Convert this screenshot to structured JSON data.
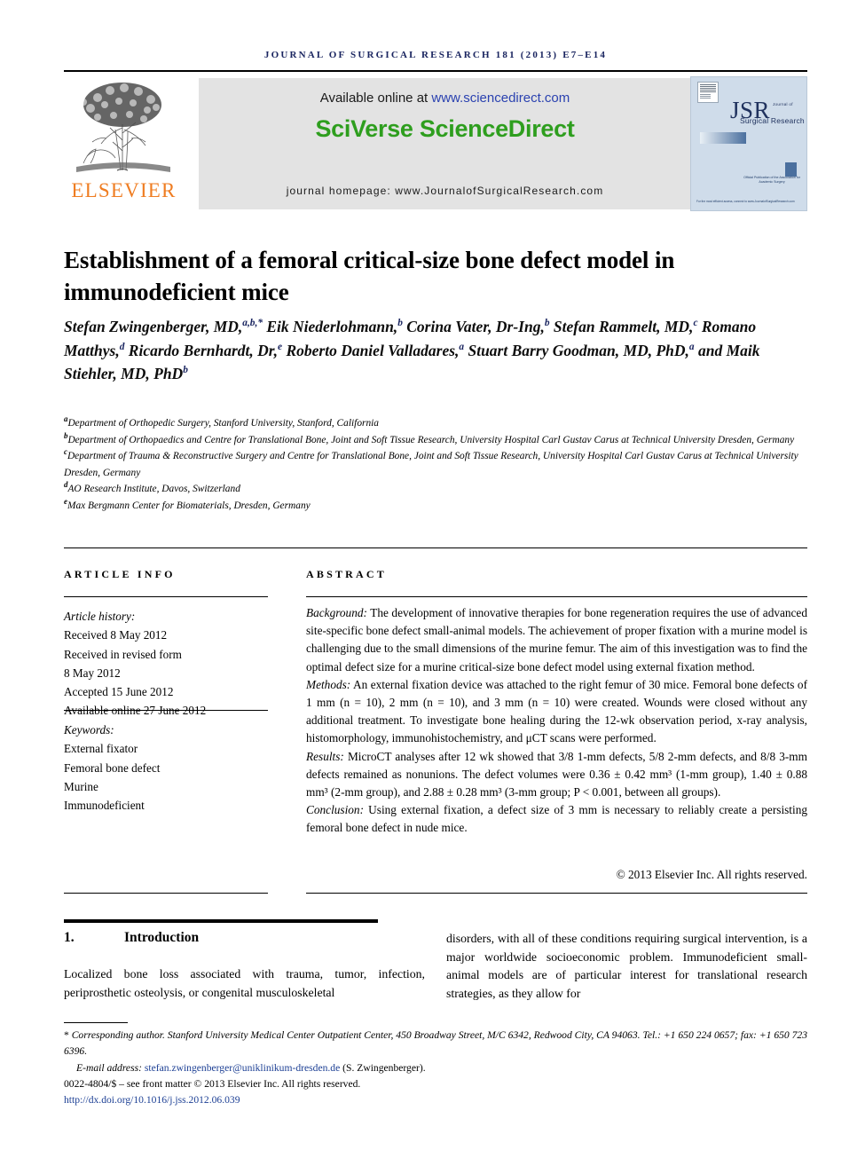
{
  "running_head": "Journal of Surgical Research 181 (2013) e7–e14",
  "masthead": {
    "publisher_name": "ELSEVIER",
    "available_prefix": "Available online at ",
    "available_url": "www.sciencedirect.com",
    "brand": "SciVerse ScienceDirect",
    "journal_homepage": "journal homepage: www.JournalofSurgicalResearch.com",
    "cover": {
      "acronym": "JSR",
      "tagline_small": "Journal of",
      "tagline": "Surgical Research",
      "association_line": "Official Publication of the Association for Academic Surgery",
      "footer_line": "For the most efficient access, connect to www.JournalofSurgicalResearch.com"
    }
  },
  "article": {
    "title": "Establishment of a femoral critical-size bone defect model in immunodeficient mice",
    "authors_html": "Stefan Zwingenberger, MD,<sup>a,b,*</sup> Eik Niederlohmann,<sup>b</sup> Corina Vater, Dr-Ing,<sup>b</sup> Stefan Rammelt, MD,<sup>c</sup> Romano Matthys,<sup>d</sup> Ricardo Bernhardt, Dr,<sup>e</sup> Roberto Daniel Valladares,<sup>a</sup> Stuart Barry Goodman, MD, PhD,<sup>a</sup> and Maik Stiehler, MD, PhD<sup>b</sup>",
    "affiliations": [
      {
        "mark": "a",
        "text": "Department of Orthopedic Surgery, Stanford University, Stanford, California"
      },
      {
        "mark": "b",
        "text": "Department of Orthopaedics and Centre for Translational Bone, Joint and Soft Tissue Research, University Hospital Carl Gustav Carus at Technical University Dresden, Germany"
      },
      {
        "mark": "c",
        "text": "Department of Trauma & Reconstructive Surgery and Centre for Translational Bone, Joint and Soft Tissue Research, University Hospital Carl Gustav Carus at Technical University Dresden, Germany"
      },
      {
        "mark": "d",
        "text": "AO Research Institute, Davos, Switzerland"
      },
      {
        "mark": "e",
        "text": "Max Bergmann Center for Biomaterials, Dresden, Germany"
      }
    ]
  },
  "article_info": {
    "label": "ARTICLE INFO",
    "history_heading": "Article history:",
    "history": [
      "Received 8 May 2012",
      "Received in revised form",
      "8 May 2012",
      "Accepted 15 June 2012",
      "Available online 27 June 2012"
    ],
    "keywords_heading": "Keywords:",
    "keywords": [
      "External fixator",
      "Femoral bone defect",
      "Murine",
      "Immunodeficient"
    ]
  },
  "abstract": {
    "label": "ABSTRACT",
    "sections": [
      {
        "lead": "Background:",
        "text": " The development of innovative therapies for bone regeneration requires the use of advanced site-specific bone defect small-animal models. The achievement of proper fixation with a murine model is challenging due to the small dimensions of the murine femur. The aim of this investigation was to find the optimal defect size for a murine critical-size bone defect model using external fixation method."
      },
      {
        "lead": "Methods:",
        "text": " An external fixation device was attached to the right femur of 30 mice. Femoral bone defects of 1 mm (n = 10), 2 mm (n = 10), and 3 mm (n = 10) were created. Wounds were closed without any additional treatment. To investigate bone healing during the 12-wk observation period, x-ray analysis, histomorphology, immunohistochemistry, and μCT scans were performed."
      },
      {
        "lead": "Results:",
        "text": " MicroCT analyses after 12 wk showed that 3/8 1-mm defects, 5/8 2-mm defects, and 8/8 3-mm defects remained as nonunions. The defect volumes were 0.36 ± 0.42 mm³ (1-mm group), 1.40 ± 0.88 mm³ (2-mm group), and 2.88 ± 0.28 mm³ (3-mm group; P < 0.001, between all groups)."
      },
      {
        "lead": "Conclusion:",
        "text": " Using external fixation, a defect size of 3 mm is necessary to reliably create a persisting femoral bone defect in nude mice."
      }
    ],
    "copyright": "© 2013 Elsevier Inc. All rights reserved."
  },
  "introduction": {
    "number": "1.",
    "heading": "Introduction",
    "column_left": "Localized bone loss associated with trauma, tumor, infection, periprosthetic osteolysis, or congenital musculoskeletal",
    "column_right": "disorders, with all of these conditions requiring surgical intervention, is a major worldwide socioeconomic problem. Immunodeficient small-animal models are of particular interest for translational research strategies, as they allow for"
  },
  "footnotes": {
    "corresponding_star": "*",
    "corresponding_label": " Corresponding author.",
    "corresponding_address": " Stanford University Medical Center Outpatient Center, 450 Broadway Street, M/C 6342, Redwood City, CA 94063. Tel.: +1 650 224 0657; fax: +1 650 723 6396.",
    "email_label": "E-mail address: ",
    "email": "stefan.zwingenberger@uniklinikum-dresden.de",
    "email_suffix": " (S. Zwingenberger).",
    "front_matter": "0022-4804/$ – see front matter © 2013 Elsevier Inc. All rights reserved.",
    "doi": "http://dx.doi.org/10.1016/j.jss.2012.06.039"
  },
  "colors": {
    "running_head": "#1a2560",
    "elsevier_orange": "#ef7d22",
    "sciencedirect_green": "#2e9e1e",
    "link_blue": "#1c3f94",
    "band_grey": "#e3e3e3"
  }
}
